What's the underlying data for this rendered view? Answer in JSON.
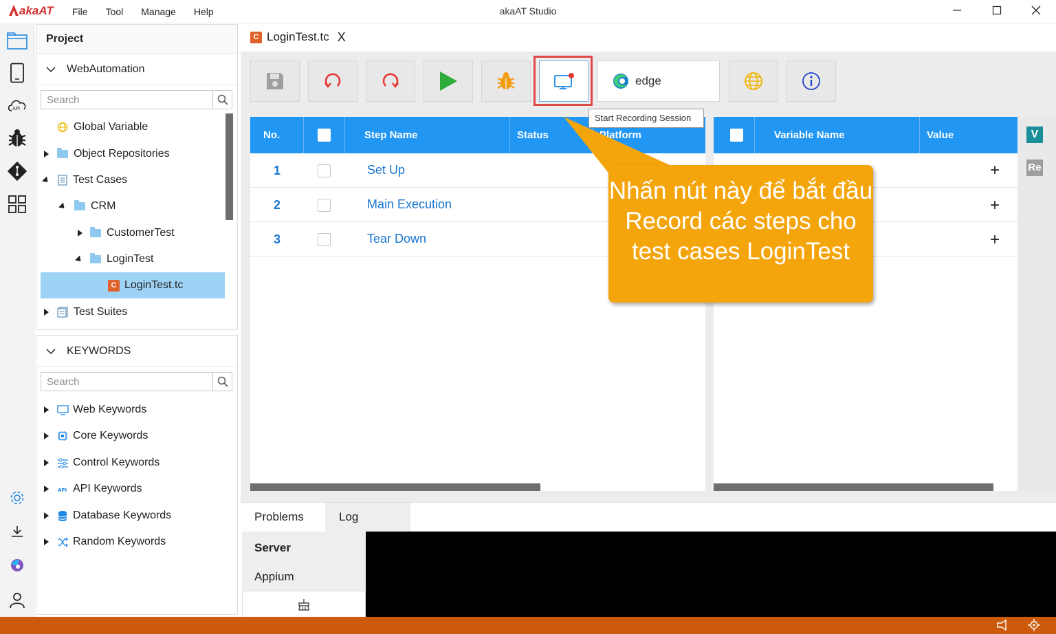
{
  "app": {
    "logo_prefix": "aka",
    "logo_suffix": "AT",
    "title": "akaAT Studio",
    "menu": [
      "File",
      "Tool",
      "Manage",
      "Help"
    ]
  },
  "project": {
    "title": "Project",
    "workspace": "WebAutomation",
    "search_placeholder": "Search",
    "tree": {
      "global_variable": "Global Variable",
      "object_repositories": "Object Repositories",
      "test_cases": "Test Cases",
      "crm": "CRM",
      "customer_test": "CustomerTest",
      "login_test": "LoginTest",
      "login_test_tc": "LoginTest.tc",
      "test_suites": "Test Suites"
    }
  },
  "keywords": {
    "title": "KEYWORDS",
    "search_placeholder": "Search",
    "items": [
      "Web Keywords",
      "Core Keywords",
      "Control Keywords",
      "API Keywords",
      "Database Keywords",
      "Random Keywords"
    ]
  },
  "editor": {
    "tab_icon": "C",
    "tab_label": "LoginTest.tc",
    "close_glyph": "X",
    "browser": "edge",
    "tooltip": "Start Recording Session"
  },
  "steps": {
    "headers": [
      "No.",
      "Step Name",
      "Status",
      "Platform"
    ],
    "rows": [
      {
        "no": "1",
        "name": "Set Up"
      },
      {
        "no": "2",
        "name": "Main Execution"
      },
      {
        "no": "3",
        "name": "Tear Down"
      }
    ]
  },
  "variables": {
    "headers": [
      "Variable Name",
      "Value"
    ],
    "add_glyph": "+"
  },
  "side_tabs": [
    "V",
    "Re"
  ],
  "callout": {
    "text": "Nhấn nút này để bắt đầu Record các steps cho test cases LoginTest"
  },
  "bottom": {
    "tabs": [
      "Problems",
      "Log"
    ],
    "servers": [
      "Server",
      "Appium"
    ]
  },
  "colors": {
    "accent": "#2196f3",
    "callout": "#f5a50c",
    "statusbar": "#cc5a0a",
    "highlight": "#e04848"
  }
}
